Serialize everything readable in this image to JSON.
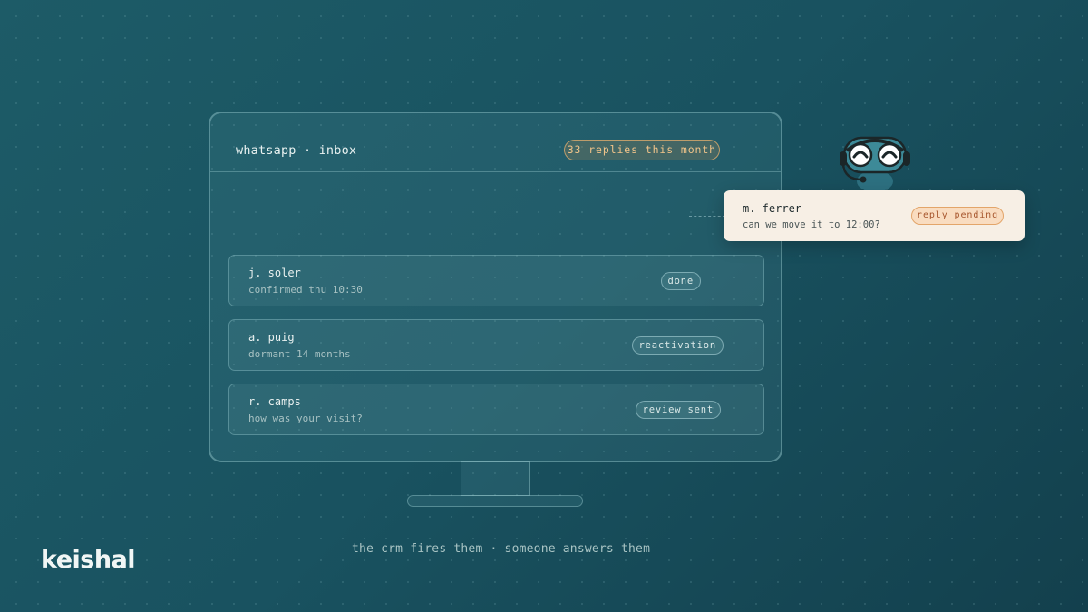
{
  "inbox": {
    "title": "whatsapp · inbox",
    "stat": "33 replies this month",
    "rows": [
      {
        "name": "j. soler",
        "detail": "confirmed thu 10:30",
        "tag": "done"
      },
      {
        "name": "a. puig",
        "detail": "dormant 14 months",
        "tag": "reactivation"
      },
      {
        "name": "r. camps",
        "detail": "how was your visit?",
        "tag": "review sent"
      }
    ]
  },
  "notification": {
    "name": "m. ferrer",
    "message": "can we move it to 12:00?",
    "status": "reply pending"
  },
  "caption": "the crm fires them · someone answers them",
  "logo": "keishal",
  "colors": {
    "background": "#195260",
    "accent_orange": "#f1c48a",
    "card": "#f7efe5",
    "mascot": "#3d8a98"
  },
  "icons": {
    "mascot": "headset-robot-mascot-icon"
  }
}
